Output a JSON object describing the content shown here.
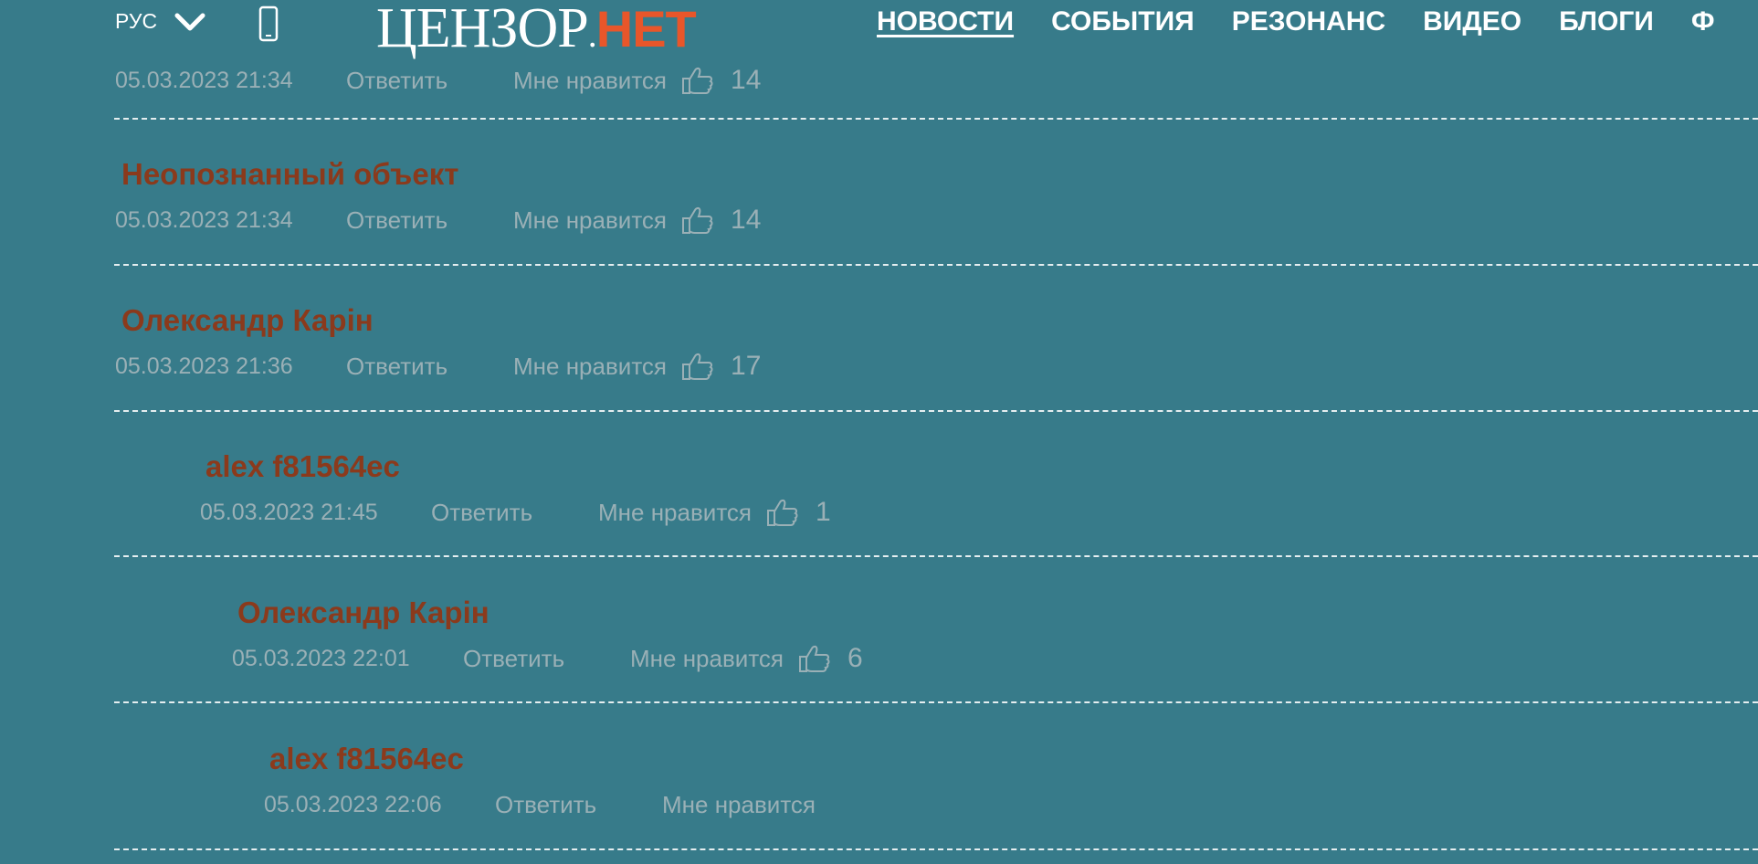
{
  "header": {
    "language": "РУС",
    "logo": {
      "part1": "ЦЕНЗОР",
      "dot": ".",
      "part2": "НЕТ"
    },
    "nav": [
      {
        "label": "НОВОСТИ",
        "active": true
      },
      {
        "label": "СОБЫТИЯ",
        "active": false
      },
      {
        "label": "РЕЗОНАНС",
        "active": false
      },
      {
        "label": "ВИДЕО",
        "active": false
      },
      {
        "label": "БЛОГИ",
        "active": false
      },
      {
        "label": "Ф",
        "active": false
      }
    ]
  },
  "colors": {
    "background": "#377b8a",
    "author": "#8b3a1c",
    "meta": "#9ab0b6",
    "logo_accent": "#e8562a"
  },
  "comments": [
    {
      "author": "",
      "date": "05.03.2023 21:34",
      "reply": "Ответить",
      "like": "Мне нравится",
      "count": "14"
    },
    {
      "author": "Неопознанный объект",
      "date": "05.03.2023 21:34",
      "reply": "Ответить",
      "like": "Мне нравится",
      "count": "14"
    },
    {
      "author": "Олександр Карін",
      "date": "05.03.2023 21:36",
      "reply": "Ответить",
      "like": "Мне нравится",
      "count": "17"
    },
    {
      "author": "alex f81564ec",
      "date": "05.03.2023 21:45",
      "reply": "Ответить",
      "like": "Мне нравится",
      "count": "1"
    },
    {
      "author": "Олександр Карін",
      "date": "05.03.2023 22:01",
      "reply": "Ответить",
      "like": "Мне нравится",
      "count": "6"
    },
    {
      "author": "alex f81564ec",
      "date": "05.03.2023 22:06",
      "reply": "Ответить",
      "like": "Мне нравится",
      "count": ""
    }
  ],
  "icons": {
    "dropdown": "chevron-down-icon",
    "mobile": "mobile-phone-icon",
    "like": "thumbs-up-icon"
  }
}
